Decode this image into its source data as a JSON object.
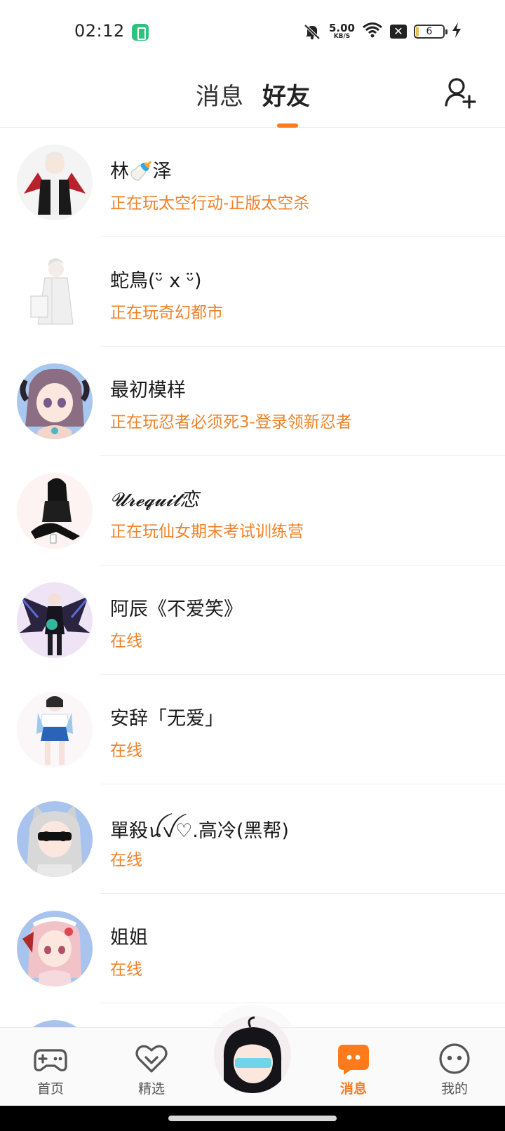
{
  "status_bar": {
    "time": "02:12",
    "net_speed_value": "5.00",
    "net_speed_unit": "KB/S",
    "battery_level": "6",
    "icons": [
      "app-notification-icon",
      "mute-icon",
      "wifi-icon",
      "no-sim-icon",
      "battery-icon",
      "charging-icon"
    ]
  },
  "header": {
    "tabs": [
      {
        "label": "消息",
        "active": false
      },
      {
        "label": "好友",
        "active": true
      }
    ],
    "accent_color": "#ff7a1a",
    "add_friend_icon": "add-user-icon"
  },
  "friends": [
    {
      "name": "林🍼泽",
      "status": "正在玩太空行动-正版太空杀"
    },
    {
      "name": "蛇鳥(ᵕ̈ x ᵕ̈)",
      "status": "正在玩奇幻都市"
    },
    {
      "name": "最初模样",
      "status": "正在玩忍者必须死3-登录领新忍者"
    },
    {
      "name": "𝓤𝓻𝓮𝓺𝓾𝓲𝓽恋",
      "status": "正在玩仙女期末考试训练营"
    },
    {
      "name": "阿辰《不爱笑》",
      "status": "在线"
    },
    {
      "name": "安辞「无爱」",
      "status": "在线"
    },
    {
      "name": "單殺ꪊꪜ♡.高冷(黑帮)",
      "status": "在线"
    },
    {
      "name": "姐姐",
      "status": "在线"
    }
  ],
  "status_color": "#f0822a",
  "bottom_nav": {
    "items": [
      {
        "label": "首页",
        "icon": "gamepad-icon",
        "active": false
      },
      {
        "label": "精选",
        "icon": "heart-chevron-icon",
        "active": false
      },
      {
        "label": "消息",
        "icon": "chat-bubble-icon",
        "active": true
      },
      {
        "label": "我的",
        "icon": "smiley-face-icon",
        "active": false
      }
    ],
    "center_icon": "user-avatar"
  }
}
